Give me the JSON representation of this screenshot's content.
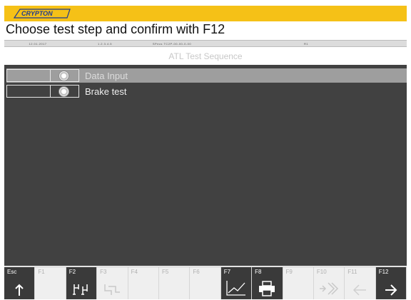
{
  "brand": {
    "logo_text": "CRYPTON"
  },
  "instruction": "Choose test step and confirm with F12",
  "status_line": [
    "12.01.2017",
    "1.2.3.4.5",
    "SPecs TC2P-00-00-0-00",
    "",
    "R1",
    ""
  ],
  "sequence": {
    "title": "ATL Test Sequence",
    "steps": [
      {
        "label": "Data Input",
        "selected": true
      },
      {
        "label": "Brake test",
        "selected": false
      }
    ]
  },
  "function_keys": [
    {
      "key": "Esc",
      "icon": "arrow-up-icon",
      "enabled": true
    },
    {
      "key": "F1",
      "icon": "",
      "enabled": false
    },
    {
      "key": "F2",
      "icon": "sequence-edit-icon",
      "enabled": true
    },
    {
      "key": "F3",
      "icon": "sequence-icon",
      "enabled": false
    },
    {
      "key": "F4",
      "icon": "",
      "enabled": false
    },
    {
      "key": "F5",
      "icon": "",
      "enabled": false
    },
    {
      "key": "F6",
      "icon": "",
      "enabled": false
    },
    {
      "key": "F7",
      "icon": "chart-icon",
      "enabled": true
    },
    {
      "key": "F8",
      "icon": "printer-icon",
      "enabled": true
    },
    {
      "key": "F9",
      "icon": "",
      "enabled": false
    },
    {
      "key": "F10",
      "icon": "forward-icon",
      "enabled": false
    },
    {
      "key": "F11",
      "icon": "arrow-left-icon",
      "enabled": false
    },
    {
      "key": "F12",
      "icon": "arrow-right-icon",
      "enabled": true
    }
  ],
  "colors": {
    "brand_yellow": "#f5c117",
    "panel_dark": "#414141",
    "selected_row": "#9e9e9e"
  }
}
